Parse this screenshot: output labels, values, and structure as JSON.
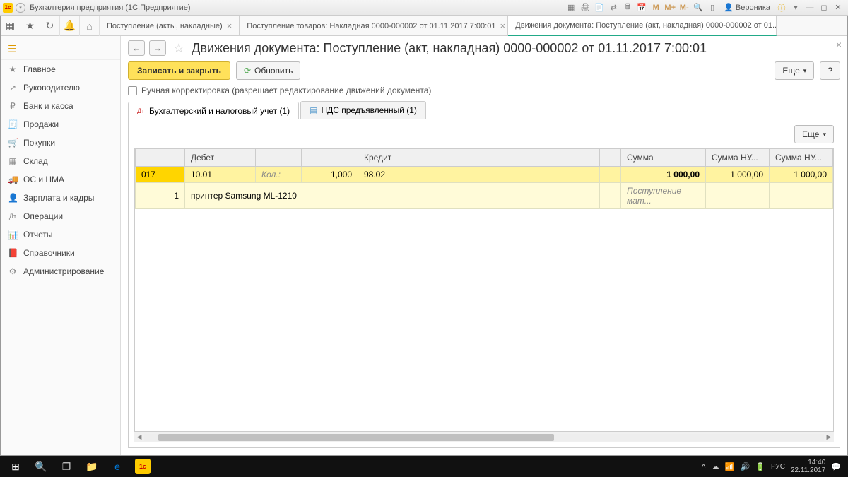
{
  "window": {
    "title": "Бухгалтерия предприятия  (1С:Предприятие)",
    "user": "Вероника"
  },
  "toolbar_icons": {
    "m": "M",
    "mp": "M+",
    "mm": "M-"
  },
  "tabs": [
    {
      "label": "Поступление (акты, накладные)"
    },
    {
      "label": "Поступление товаров: Накладная 0000-000002 от 01.11.2017 7:00:01"
    },
    {
      "label": "Движения документа: Поступление (акт, накладная) 0000-000002 от 01..."
    }
  ],
  "sidebar": [
    {
      "icon": "≡",
      "label": "Главное"
    },
    {
      "icon": "↗",
      "label": "Руководителю"
    },
    {
      "icon": "₽",
      "label": "Банк и касса"
    },
    {
      "icon": "🧾",
      "label": "Продажи"
    },
    {
      "icon": "🛒",
      "label": "Покупки"
    },
    {
      "icon": "▦",
      "label": "Склад"
    },
    {
      "icon": "🚚",
      "label": "ОС и НМА"
    },
    {
      "icon": "👤",
      "label": "Зарплата и кадры"
    },
    {
      "icon": "Дт",
      "label": "Операции"
    },
    {
      "icon": "📊",
      "label": "Отчеты"
    },
    {
      "icon": "📕",
      "label": "Справочники"
    },
    {
      "icon": "⚙",
      "label": "Администрирование"
    }
  ],
  "doc": {
    "title": "Движения документа: Поступление (акт, накладная) 0000-000002 от 01.11.2017 7:00:01",
    "save_close": "Записать и закрыть",
    "refresh": "Обновить",
    "more": "Еще",
    "help": "?",
    "manual_chk": "Ручная корректировка (разрешает редактирование движений документа)"
  },
  "inner_tabs": [
    {
      "label": "Бухгалтерский и налоговый учет (1)"
    },
    {
      "label": "НДС предъявленный (1)"
    }
  ],
  "grid": {
    "more": "Еще",
    "headers": {
      "c1": "",
      "c2": "Дебет",
      "c3": "",
      "c4": "",
      "c5": "Кредит",
      "c6": "",
      "c7": "Сумма",
      "c8": "Сумма НУ...",
      "c9": "Сумма НУ..."
    },
    "row1": {
      "date_frag": "017",
      "debit": "10.01",
      "kol_lbl": "Кол.:",
      "kol": "1,000",
      "credit": "98.02",
      "sum": "1 000,00",
      "sumnu1": "1 000,00",
      "sumnu2": "1 000,00"
    },
    "row2": {
      "num": "1",
      "item": "принтер Samsung ML-1210",
      "desc": "Поступление мат..."
    }
  },
  "tray": {
    "lang": "РУС",
    "time": "14:40",
    "date": "22.11.2017"
  }
}
